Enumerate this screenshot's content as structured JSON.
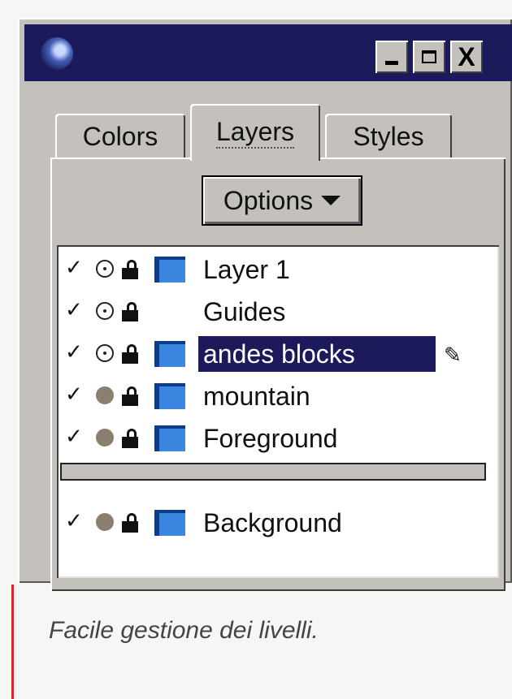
{
  "window": {
    "icon": "app-logo-icon",
    "controls": [
      "minimize-icon",
      "maximize-icon",
      "close-icon"
    ],
    "close_label": "X"
  },
  "tabs": [
    {
      "label": "Colors"
    },
    {
      "label": "Layers",
      "active": true
    },
    {
      "label": "Styles"
    }
  ],
  "options_button": {
    "label": "Options",
    "icon": "chevron-down-icon"
  },
  "layers": [
    {
      "name": "Layer 1",
      "visible": true,
      "eye": "open",
      "locked": false,
      "swatch": true
    },
    {
      "name": "Guides",
      "visible": true,
      "eye": "open",
      "locked": false,
      "swatch": false
    },
    {
      "name": "andes blocks",
      "visible": true,
      "eye": "open",
      "locked": false,
      "swatch": true,
      "selected": true
    },
    {
      "name": "mountain",
      "visible": true,
      "eye": "filled",
      "locked": false,
      "swatch": true
    },
    {
      "name": "Foreground",
      "visible": true,
      "eye": "filled",
      "locked": false,
      "swatch": true
    },
    {
      "name": "Background",
      "visible": true,
      "eye": "filled",
      "locked": false,
      "swatch": true
    }
  ],
  "colors": {
    "titlebar": "#1c1a5a",
    "swatch": "#3a86e0",
    "selection": "#1c1a5a"
  },
  "caption": "Facile gestione dei livelli."
}
